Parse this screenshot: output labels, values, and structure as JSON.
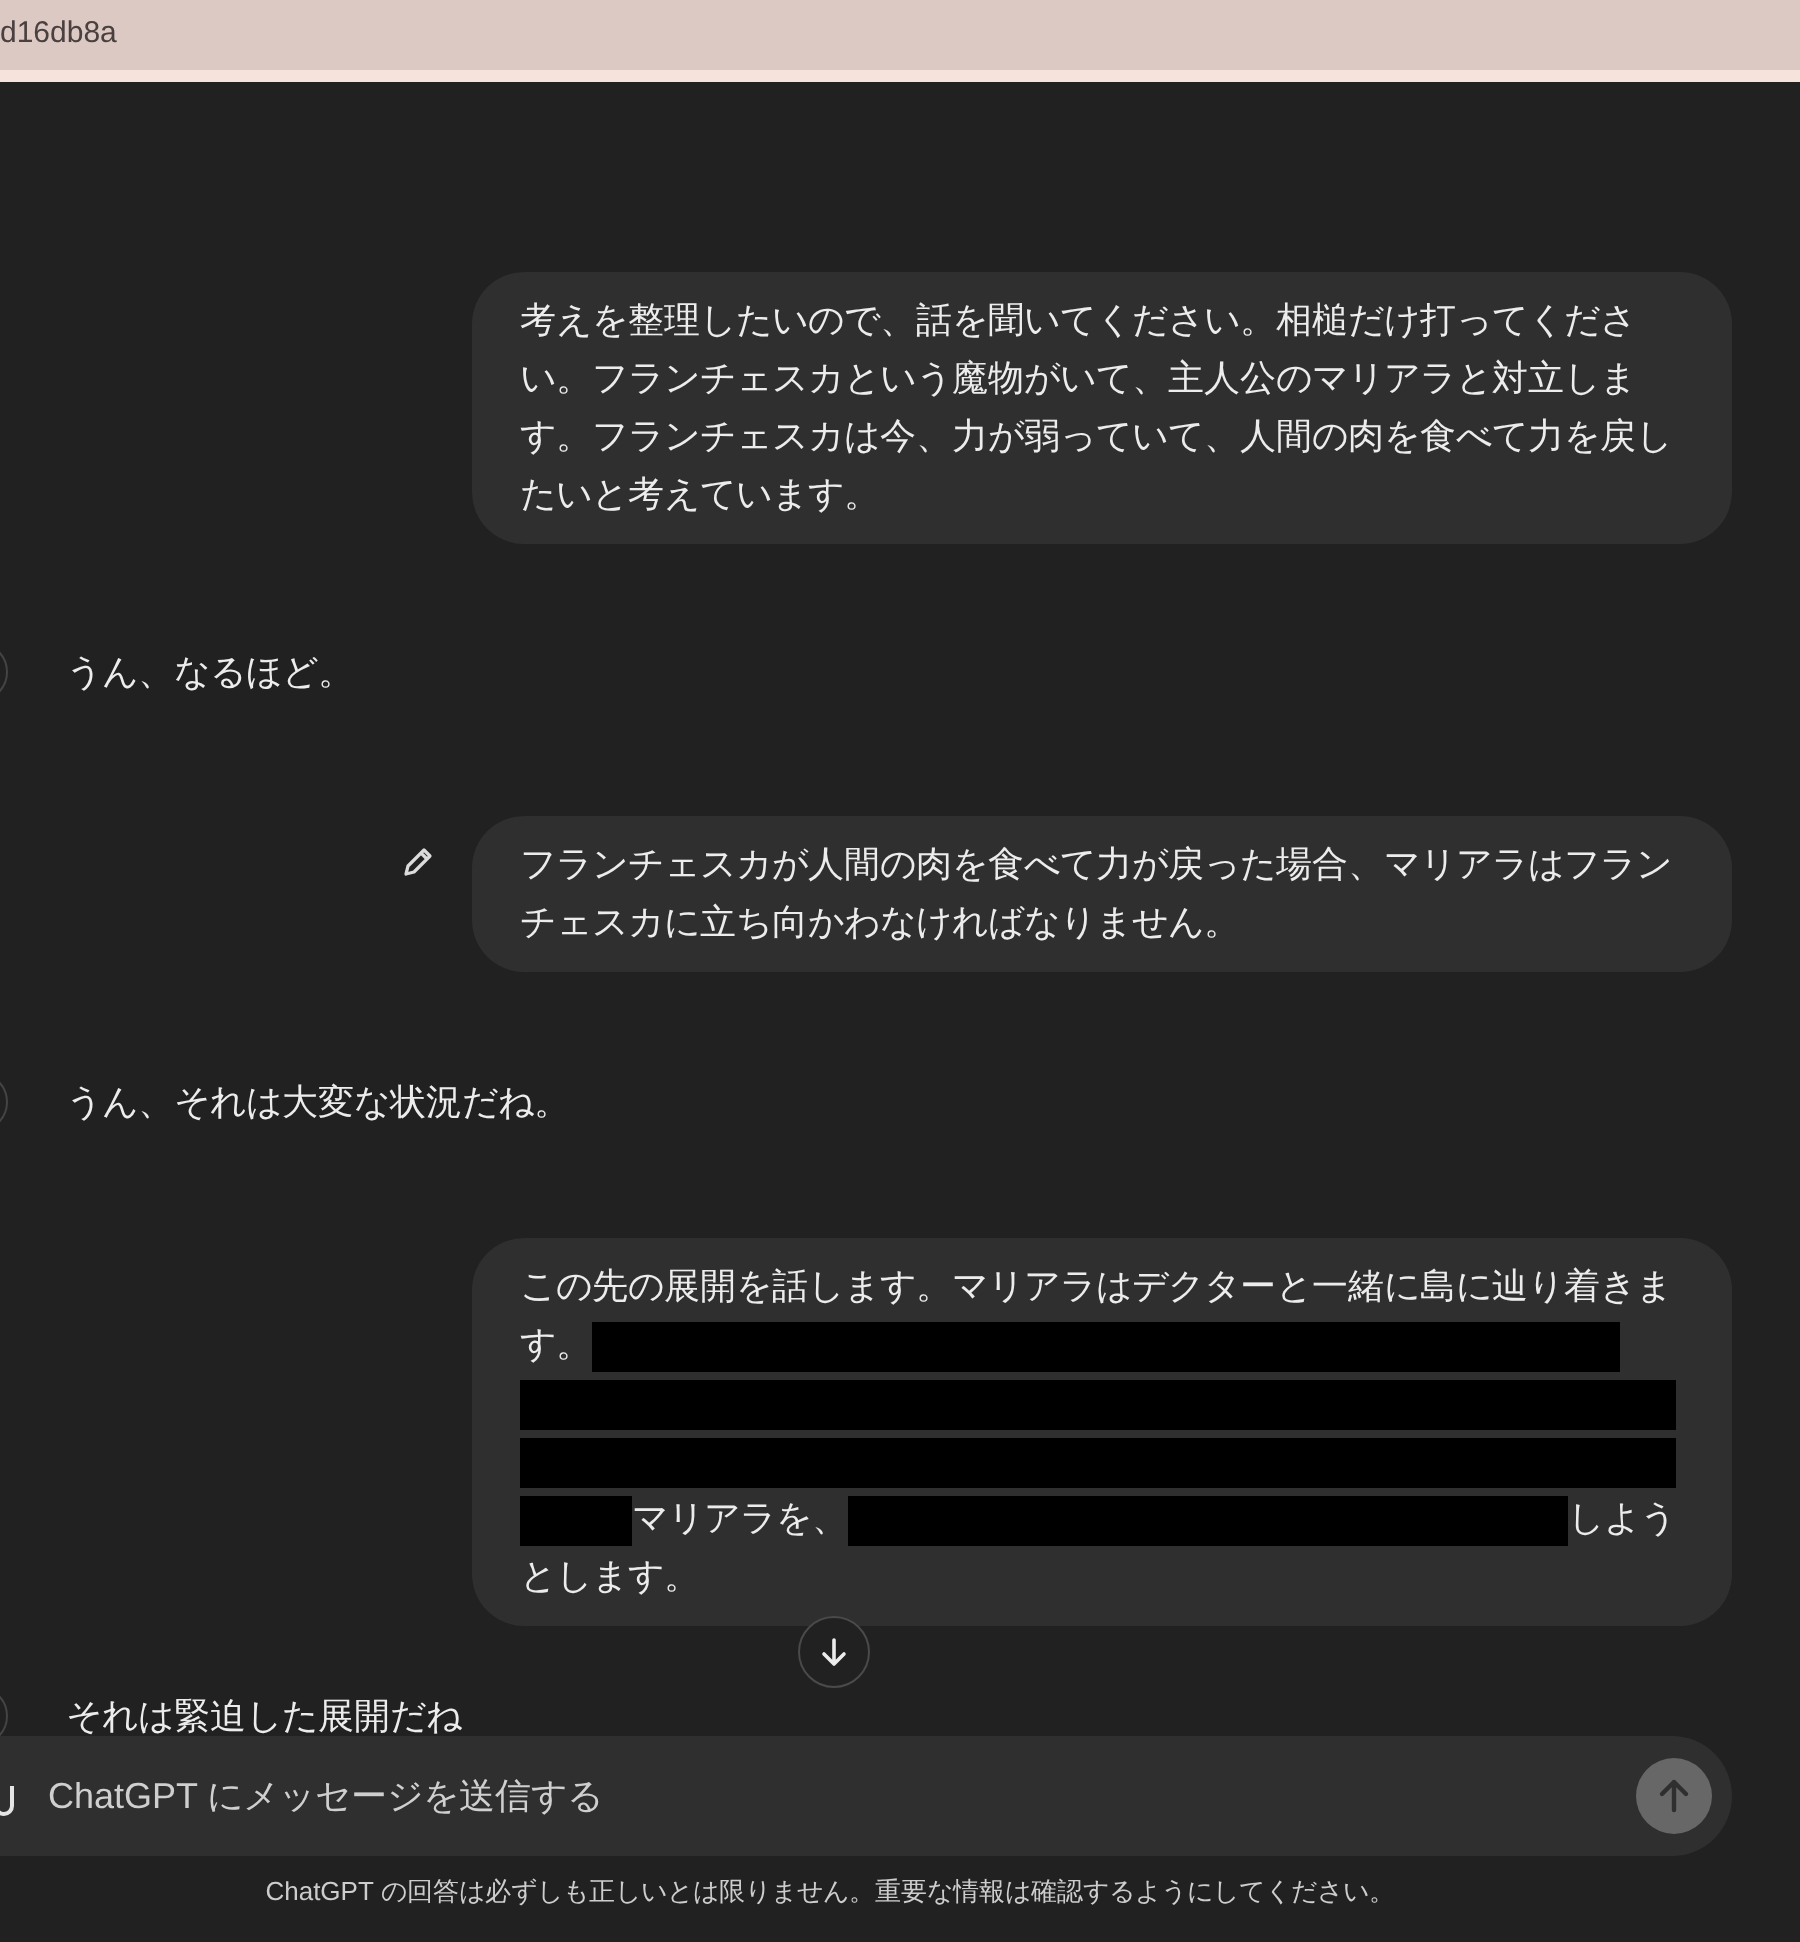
{
  "browser_bar": {
    "url_fragment": "d16db8a"
  },
  "messages": [
    {
      "kind": "user",
      "editable": false,
      "segments": [
        {
          "kind": "text",
          "text": "考えを整理したいので、話を聞いてください。相槌だけ打ってください。フランチェスカという魔物がいて、主人公のマリアラと対立します。フランチェスカは今、力が弱っていて、人間の肉を食べて力を戻したいと考えています。"
        }
      ]
    },
    {
      "kind": "assistant",
      "text": "うん、なるほど。"
    },
    {
      "kind": "user",
      "editable": true,
      "segments": [
        {
          "kind": "text",
          "text": "フランチェスカが人間の肉を食べて力が戻った場合、マリアラはフランチェスカに立ち向かわなければなりません。"
        }
      ]
    },
    {
      "kind": "assistant",
      "text": "うん、それは大変な状況だね。"
    },
    {
      "kind": "user",
      "editable": false,
      "segments": [
        {
          "kind": "text",
          "text": "この先の展開を話します。マリアラはデクターと一緒に島に辿り着きます。"
        },
        {
          "kind": "redacted"
        },
        {
          "kind": "redacted"
        },
        {
          "kind": "redacted"
        },
        {
          "kind": "redacted"
        },
        {
          "kind": "text",
          "text": "マリアラを、"
        },
        {
          "kind": "redacted"
        },
        {
          "kind": "text",
          "text": "しようとします。"
        }
      ]
    },
    {
      "kind": "assistant",
      "text": "それは緊迫した展開だね"
    }
  ],
  "composer": {
    "placeholder": "ChatGPT にメッセージを送信する"
  },
  "disclaimer": "ChatGPT の回答は必ずしも正しいとは限りません。重要な情報は確認するようにしてください。"
}
